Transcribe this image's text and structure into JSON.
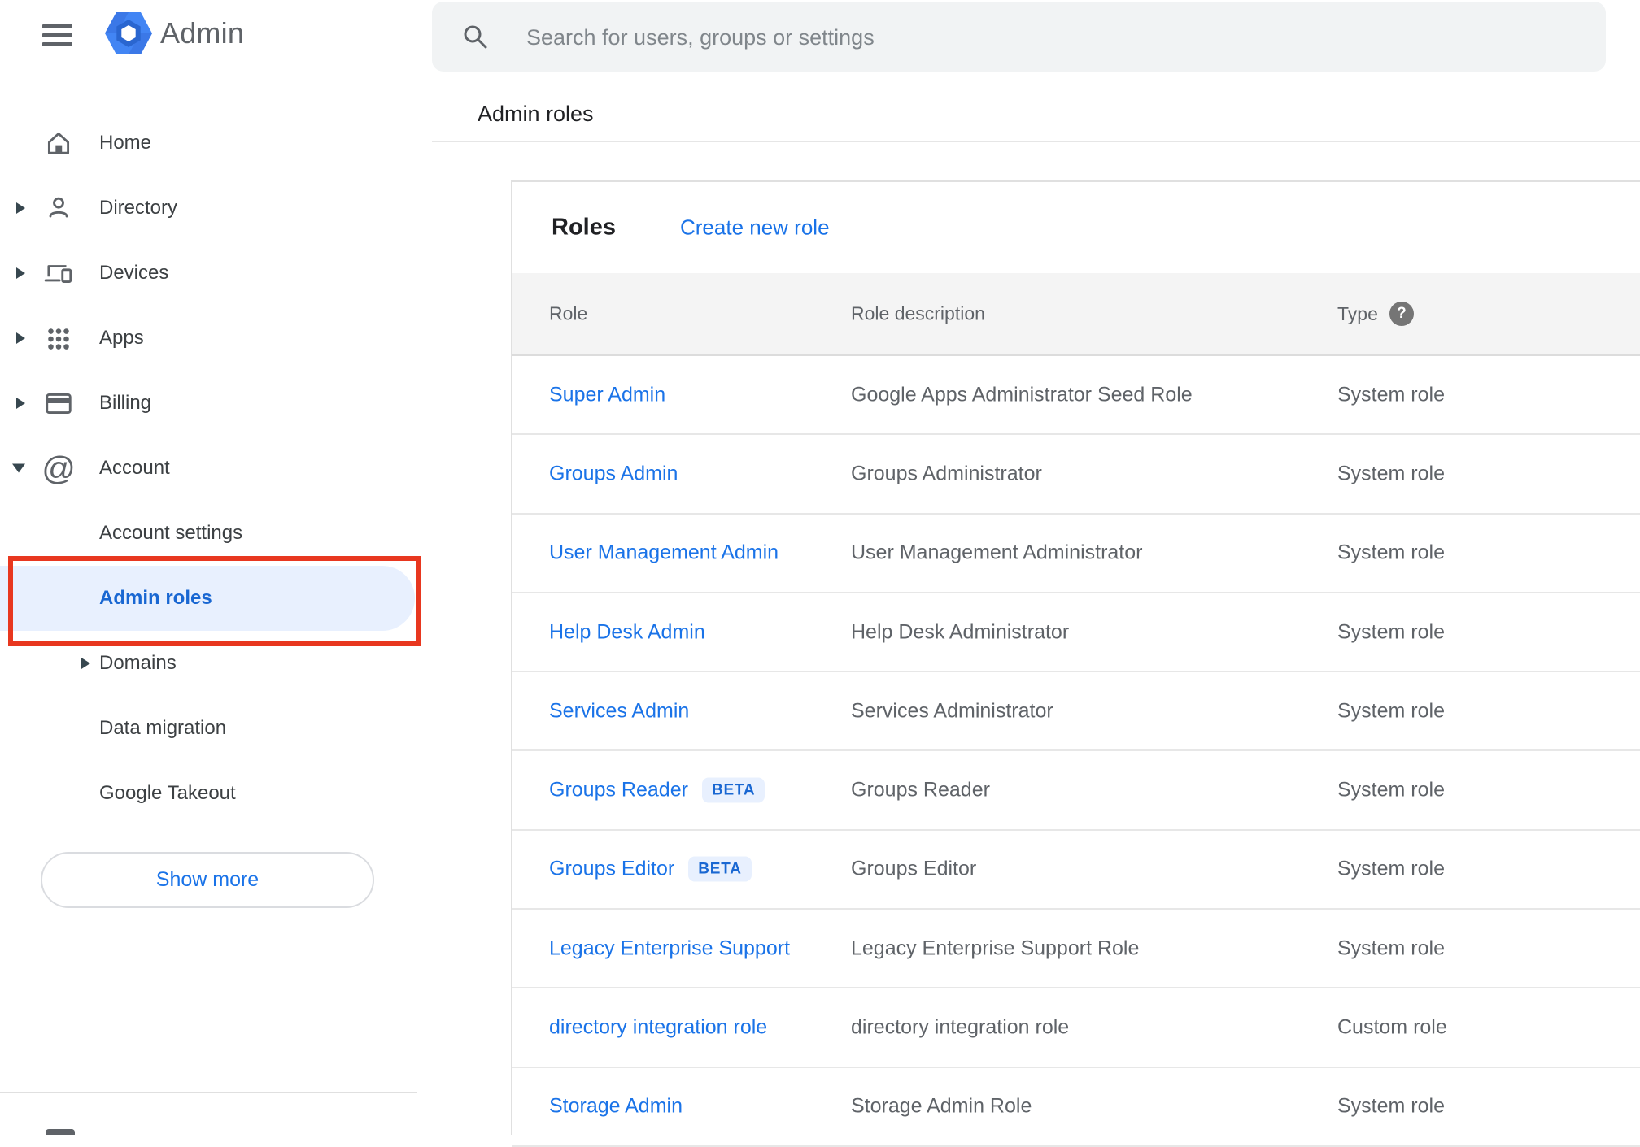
{
  "topbar": {
    "logo_text": "Admin",
    "search_placeholder": "Search for users, groups or settings"
  },
  "breadcrumb": "Admin roles",
  "sidebar": {
    "items": [
      {
        "label": "Home",
        "icon": "home-icon",
        "caret": null
      },
      {
        "label": "Directory",
        "icon": "person-icon",
        "caret": "right"
      },
      {
        "label": "Devices",
        "icon": "devices-icon",
        "caret": "right"
      },
      {
        "label": "Apps",
        "icon": "apps-grid-icon",
        "caret": "right"
      },
      {
        "label": "Billing",
        "icon": "credit-card-icon",
        "caret": "right"
      },
      {
        "label": "Account",
        "icon": "at-sign-icon",
        "caret": "down"
      }
    ],
    "account_subitems": [
      {
        "label": "Account settings",
        "caret": null,
        "selected": false
      },
      {
        "label": "Admin roles",
        "caret": null,
        "selected": true
      },
      {
        "label": "Domains",
        "caret": "right",
        "selected": false
      },
      {
        "label": "Data migration",
        "caret": null,
        "selected": false
      },
      {
        "label": "Google Takeout",
        "caret": null,
        "selected": false
      }
    ],
    "show_more_label": "Show more"
  },
  "content": {
    "title": "Roles",
    "create_link": "Create new role",
    "table": {
      "columns": [
        "Role",
        "Role description",
        "Type"
      ],
      "rows": [
        {
          "role": "Super Admin",
          "badge": null,
          "description": "Google Apps Administrator Seed Role",
          "type": "System role"
        },
        {
          "role": "Groups Admin",
          "badge": null,
          "description": "Groups Administrator",
          "type": "System role"
        },
        {
          "role": "User Management Admin",
          "badge": null,
          "description": "User Management Administrator",
          "type": "System role"
        },
        {
          "role": "Help Desk Admin",
          "badge": null,
          "description": "Help Desk Administrator",
          "type": "System role"
        },
        {
          "role": "Services Admin",
          "badge": null,
          "description": "Services Administrator",
          "type": "System role"
        },
        {
          "role": "Groups Reader",
          "badge": "BETA",
          "description": "Groups Reader",
          "type": "System role"
        },
        {
          "role": "Groups Editor",
          "badge": "BETA",
          "description": "Groups Editor",
          "type": "System role"
        },
        {
          "role": "Legacy Enterprise Support",
          "badge": null,
          "description": "Legacy Enterprise Support Role",
          "type": "System role"
        },
        {
          "role": "directory integration role",
          "badge": null,
          "description": "directory integration role",
          "type": "Custom role"
        },
        {
          "role": "Storage Admin",
          "badge": null,
          "description": "Storage Admin Role",
          "type": "System role"
        }
      ]
    }
  },
  "colors": {
    "link_blue": "#1a73e8",
    "selected_item_text": "#1967d2",
    "selected_item_bg": "#e8f0fe",
    "beta_badge_bg": "#e8f0fe",
    "beta_badge_text": "#1967d2",
    "annotation_red": "#e8371f",
    "logo_blue": "#4285f4",
    "table_header_bg": "#f4f4f4"
  }
}
